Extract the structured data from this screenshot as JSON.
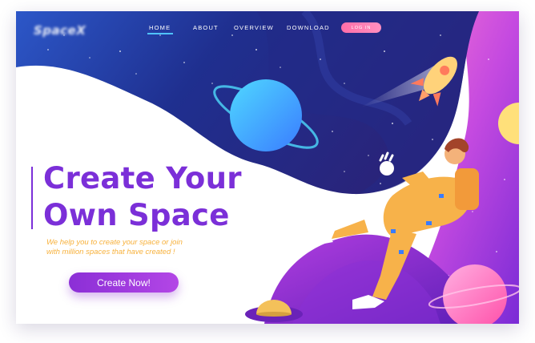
{
  "brand": {
    "logo_text": "SpaceX"
  },
  "nav": {
    "items": [
      {
        "label": "HOME",
        "active": true
      },
      {
        "label": "ABOUT",
        "active": false
      },
      {
        "label": "OVERVIEW",
        "active": false
      },
      {
        "label": "DOWNLOAD",
        "active": false
      }
    ],
    "login_label": "LOG IN"
  },
  "hero": {
    "title_line1": "Create Your",
    "title_line2": "Own Space",
    "subtitle_line1": "We help you to create your space or join",
    "subtitle_line2": "with million spaces that have created !",
    "cta_label": "Create Now!"
  },
  "colors": {
    "primary_purple": "#7b2fd8",
    "subtitle_orange": "#f7b13c",
    "login_pink": "#ff6ea8",
    "space_navy": "#1f2f8f",
    "nav_underline": "#4fc3ff"
  },
  "illustration": {
    "elements": [
      "starry-space-wave",
      "blue-ringed-planet",
      "rocket-icon",
      "astronaut",
      "pink-planet",
      "yellow-moon",
      "ufo-icon"
    ]
  }
}
